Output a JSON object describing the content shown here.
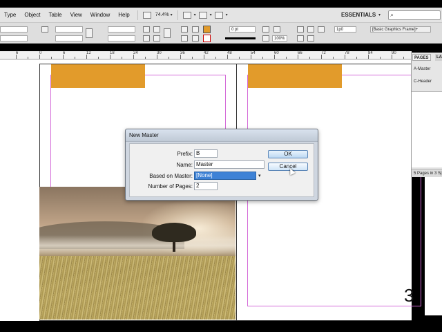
{
  "menubar": {
    "items": [
      "Type",
      "Object",
      "Table",
      "View",
      "Window",
      "Help"
    ],
    "zoom": "74.4%",
    "workspace": "ESSENTIALS"
  },
  "control": {
    "stroke_weight": "0 pt",
    "scale": "100%",
    "measure": "1p0",
    "object_style": "[Basic Graphics Frame]+"
  },
  "ruler": {
    "labels": [
      "6",
      "0",
      "6",
      "12",
      "18",
      "24",
      "30",
      "36",
      "42",
      "48",
      "54",
      "60",
      "66",
      "72",
      "78",
      "84",
      "90"
    ]
  },
  "document": {
    "page_number": "3"
  },
  "pages_panel": {
    "tabs": [
      "PAGES",
      "LA"
    ],
    "items": [
      "A-Master",
      "C-Header"
    ],
    "footer": "5 Pages in 3 Sp"
  },
  "dialog": {
    "title": "New Master",
    "prefix_label": "Prefix:",
    "prefix_value": "B",
    "name_label": "Name:",
    "name_value": "Master",
    "based_on_label": "Based on Master:",
    "based_on_value": "[None]",
    "pages_label": "Number of Pages:",
    "pages_value": "2",
    "ok_label": "OK",
    "cancel_label": "Cancel"
  },
  "colors": {
    "orange_block": "#e29b2b",
    "margin_guide": "#d46bd8",
    "selection": "#3e82d6"
  }
}
